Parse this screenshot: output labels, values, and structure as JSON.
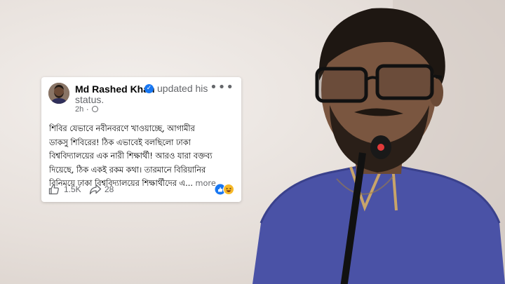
{
  "post": {
    "author": "Md Rashed Khan",
    "action_line1": "updated his",
    "action_line2": "status.",
    "time": "2h",
    "time_sep": "·",
    "menu": "•••",
    "text_lines": [
      "শিবির যেভাবে নবীনবরণে খাওয়াচ্ছে, আগামীর",
      "ডাকসু শিবিরের! ঠিক এভাবেই বলছিলো ঢাকা",
      "বিশ্ববিদ্যালয়ের এক নারী শিক্ষার্থী! আরও যারা বক্তব্য",
      "দিয়েছে, ঠিক একই রকম কথা। তারমানে বিরিয়ানির",
      "বিনিময়ে ঢাকা বিশ্ববিদ্যালয়ের শিক্ষার্থীদের এ..."
    ],
    "more_label": "more",
    "likes": "1.5K",
    "shares": "28"
  },
  "colors": {
    "facebook_blue": "#1877f2",
    "text_primary": "#050505",
    "text_secondary": "#65676b",
    "kurta": "#4a52a6"
  },
  "icons": {
    "verified": "verified-badge-icon",
    "privacy": "globe-icon",
    "like": "thumbs-up-icon",
    "share": "share-arrow-icon",
    "reactions": "like-haha-reaction-icons"
  }
}
